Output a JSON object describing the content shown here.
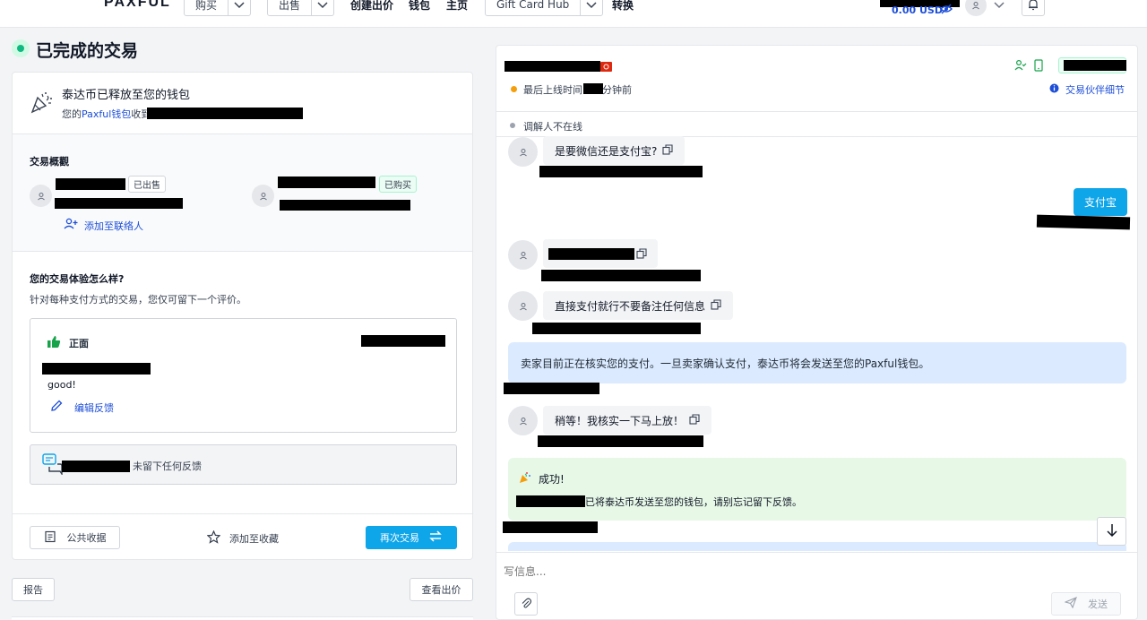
{
  "nav": {
    "logo": "PAXFUL",
    "buy_label": "购买",
    "sell_label": "出售",
    "create_offer": "创建出价",
    "wallet": "钱包",
    "home": "主页",
    "gift_card_hub": "Gift Card Hub",
    "convert": "转换",
    "balance": "0.00 USD"
  },
  "page": {
    "title": "已完成的交易"
  },
  "release": {
    "title": "泰达币已释放至您的钱包",
    "prefix": "您的",
    "wallet_link": "Paxful钱包",
    "suffix": "收到"
  },
  "overview": {
    "heading": "交易概觀",
    "seller_tag": "已出售",
    "buyer_tag": "已购买",
    "add_contact": "添加至联络人"
  },
  "feedback": {
    "question": "您的交易体验怎么样?",
    "note": "针对每种支付方式的交易，您仅可留下一个评价。",
    "rating_label": "正面",
    "comment": "good!",
    "edit_label": "编辑反馈",
    "partner_none": "未留下任何反馈"
  },
  "actions": {
    "receipt": "公共收据",
    "favorite": "添加至收藏",
    "trade_again": "再次交易",
    "report": "报告",
    "view_offer": "查看出价"
  },
  "chat": {
    "last_online_prefix": "最后上线时间",
    "last_online_suffix": "分钟前",
    "partner_details": "交易伙伴细节",
    "mediator_status": "调解人不在线",
    "msg1": "是要微信还是支付宝?",
    "msg2": "支付宝",
    "msg4": "直接支付就行不要备注任何信息",
    "sys1": "卖家目前正在核实您的支付。一旦卖家确认支付，泰达币将会发送至您的Paxful钱包。",
    "msg5": "稍等！我核实一下马上放！",
    "success_title": "成功!",
    "success_text": "已将泰达币发送至您的钱包，请别忘记留下反馈。",
    "input_placeholder": "写信息...",
    "send_label": "发送"
  },
  "colors": {
    "accent": "#0ea5e9",
    "success": "#10b981",
    "link": "#1d4ed8",
    "sys_blue": "#dbeafe",
    "sys_green": "#e7f8e7",
    "online_dot": "#f59e0b"
  }
}
